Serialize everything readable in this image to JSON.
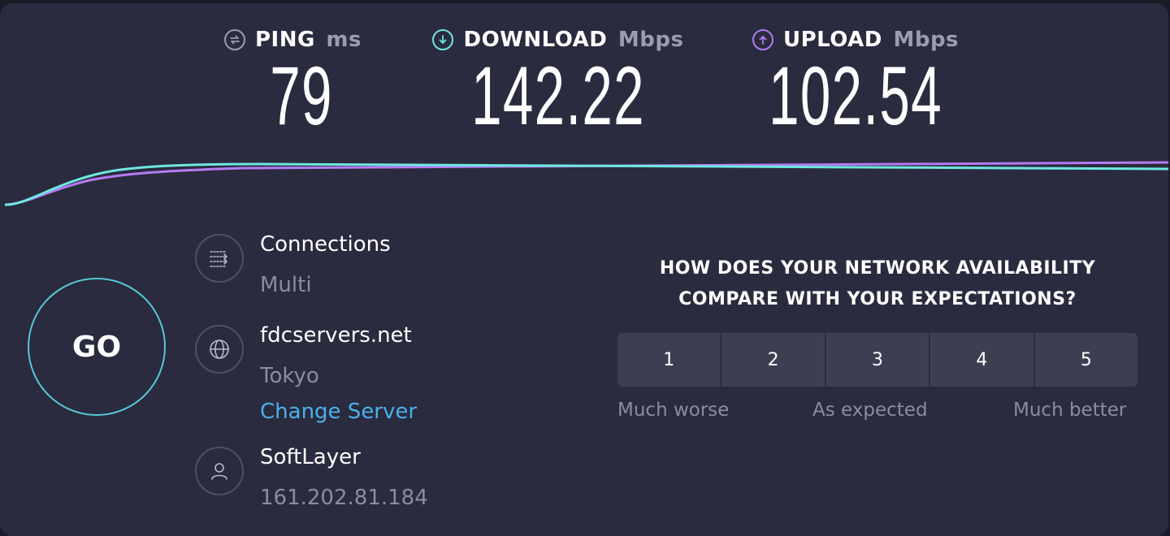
{
  "metrics": {
    "ping": {
      "label": "PING",
      "unit": "ms",
      "value": "79",
      "color": "#9c9cad"
    },
    "download": {
      "label": "DOWNLOAD",
      "unit": "Mbps",
      "value": "142.22",
      "color": "#6ee7e0"
    },
    "upload": {
      "label": "UPLOAD",
      "unit": "Mbps",
      "value": "102.54",
      "color": "#b57bf2"
    }
  },
  "go_button": {
    "label": "GO"
  },
  "connections": {
    "title": "Connections",
    "value": "Multi",
    "icon": "connections-icon"
  },
  "server": {
    "host": "fdcservers.net",
    "location": "Tokyo",
    "change_label": "Change Server",
    "icon": "globe-icon"
  },
  "provider": {
    "name": "SoftLayer",
    "ip": "161.202.81.184",
    "icon": "user-icon"
  },
  "survey": {
    "question_line1": "HOW DOES YOUR NETWORK AVAILABILITY",
    "question_line2": "COMPARE WITH YOUR EXPECTATIONS?",
    "options": [
      "1",
      "2",
      "3",
      "4",
      "5"
    ],
    "low_label": "Much worse",
    "mid_label": "As expected",
    "high_label": "Much better"
  },
  "colors": {
    "accent_cyan": "#6ee7e0",
    "accent_purple": "#b57bf2",
    "link_blue": "#4ab0ea",
    "background": "#2a2b3e"
  }
}
